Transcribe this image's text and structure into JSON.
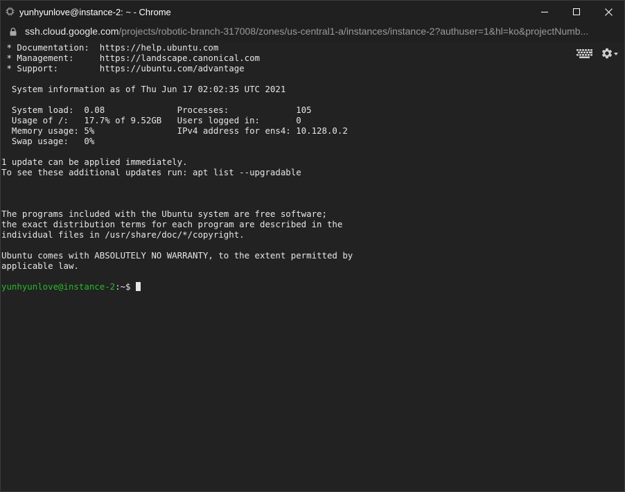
{
  "window": {
    "title": "yunhyunlove@instance-2: ~ - Chrome",
    "controls": [
      "minimize",
      "maximize",
      "close"
    ]
  },
  "address_bar": {
    "host": "ssh.cloud.google.com",
    "path": "/projects/robotic-branch-317008/zones/us-central1-a/instances/instance-2?authuser=1&hl=ko&projectNumb..."
  },
  "toolbar": {
    "keyboard_icon": "keyboard-icon",
    "settings_icon": "gear-icon"
  },
  "terminal": {
    "lines": [
      " * Documentation:  https://help.ubuntu.com",
      " * Management:     https://landscape.canonical.com",
      " * Support:        https://ubuntu.com/advantage",
      "",
      "  System information as of Thu Jun 17 02:02:35 UTC 2021",
      "",
      "  System load:  0.08              Processes:             105",
      "  Usage of /:   17.7% of 9.52GB   Users logged in:       0",
      "  Memory usage: 5%                IPv4 address for ens4: 10.128.0.2",
      "  Swap usage:   0%",
      "",
      "1 update can be applied immediately.",
      "To see these additional updates run: apt list --upgradable",
      "",
      "",
      "",
      "The programs included with the Ubuntu system are free software;",
      "the exact distribution terms for each program are described in the",
      "individual files in /usr/share/doc/*/copyright.",
      "",
      "Ubuntu comes with ABSOLUTELY NO WARRANTY, to the extent permitted by",
      "applicable law.",
      ""
    ],
    "prompt_user": "yunhyunlove@instance-2",
    "prompt_rest": ":~$ "
  },
  "colors": {
    "background": "#222222",
    "text": "#e6e6e6",
    "prompt_green": "#28b92a",
    "titlebar": "#202020"
  }
}
